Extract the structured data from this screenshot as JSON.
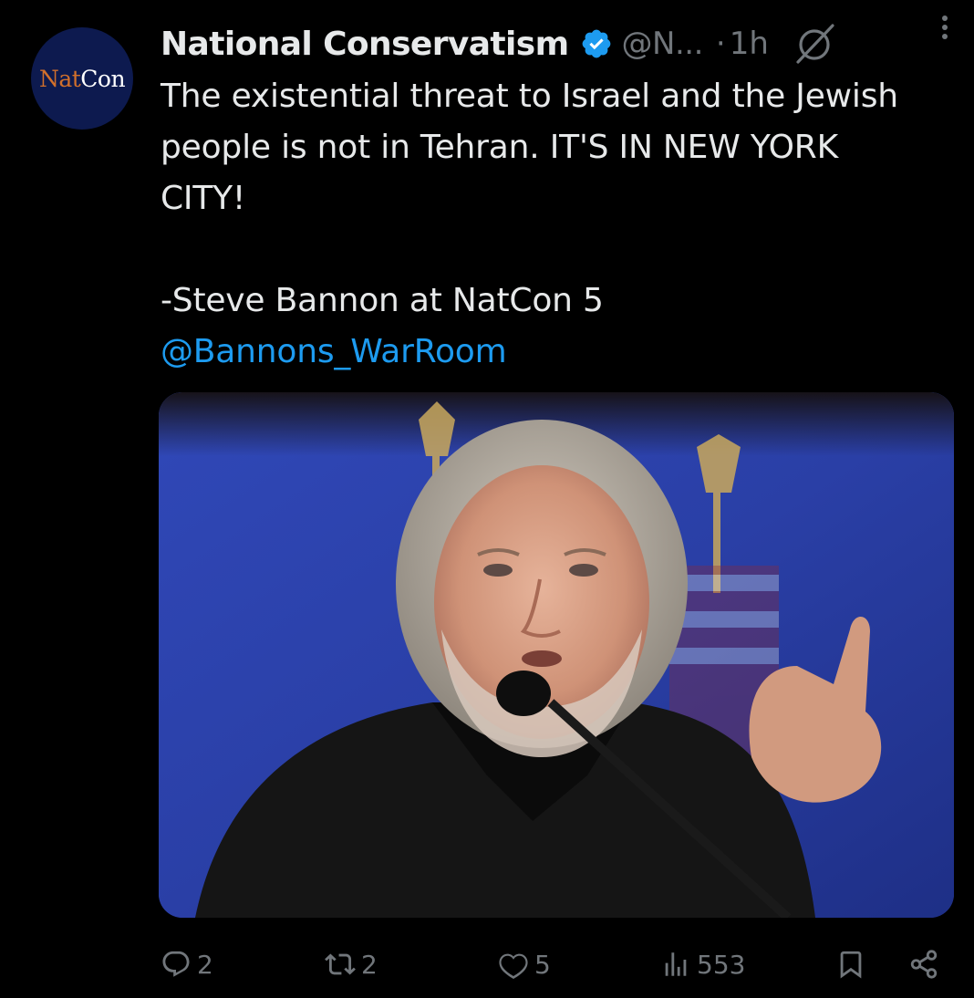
{
  "author": {
    "avatar_text_1": "Nat",
    "avatar_text_2": "Con",
    "display_name": "National Conservatism",
    "handle": "@N...",
    "separator": "·",
    "time": "1h"
  },
  "tweet": {
    "lines": [
      "The existential threat to Israel and the Jewish",
      "people is not in Tehran. IT'S IN NEW YORK",
      "CITY!"
    ],
    "attribution": "-Steve Bannon at NatCon 5",
    "mention": "@Bannons_WarRoom"
  },
  "actions": {
    "replies": "2",
    "reposts": "2",
    "likes": "5",
    "views": "553"
  },
  "colors": {
    "background": "#000000",
    "text": "#e7e9ea",
    "secondary": "#71767b",
    "accent": "#1d9bf0",
    "avatar_bg": "#0d1a4f"
  },
  "icons": {
    "verified": "verified-badge-icon",
    "grok": "grok-icon",
    "more": "more-vertical-icon",
    "reply": "reply-icon",
    "repost": "repost-icon",
    "like": "heart-icon",
    "views": "views-icon",
    "bookmark": "bookmark-icon",
    "share": "share-icon"
  }
}
